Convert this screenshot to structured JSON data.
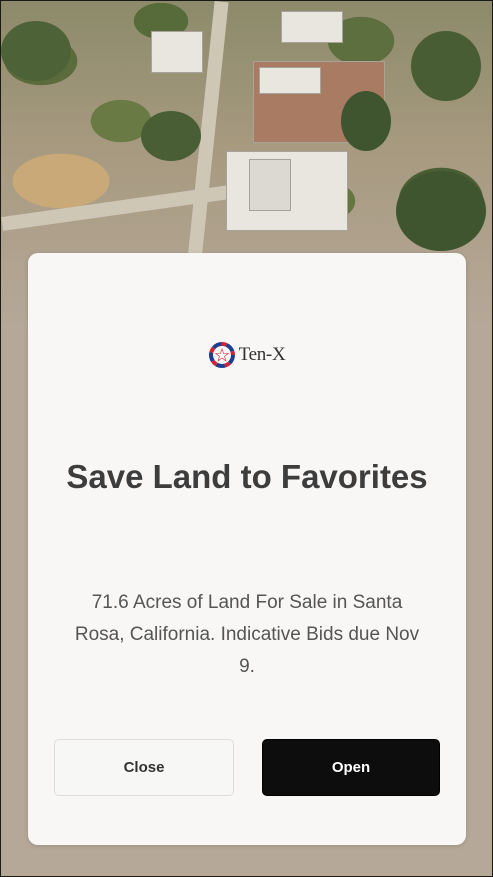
{
  "modal": {
    "brand_name": "Ten-X",
    "brand_colors": {
      "red": "#d6202f",
      "blue": "#1c3f8f"
    },
    "title": "Save Land to Favorites",
    "description": "71.6 Acres of Land For Sale in Santa Rosa, California. Indicative Bids due Nov 9.",
    "close_label": "Close",
    "open_label": "Open"
  },
  "background": {
    "image_icon": "aerial-photo-icon"
  }
}
